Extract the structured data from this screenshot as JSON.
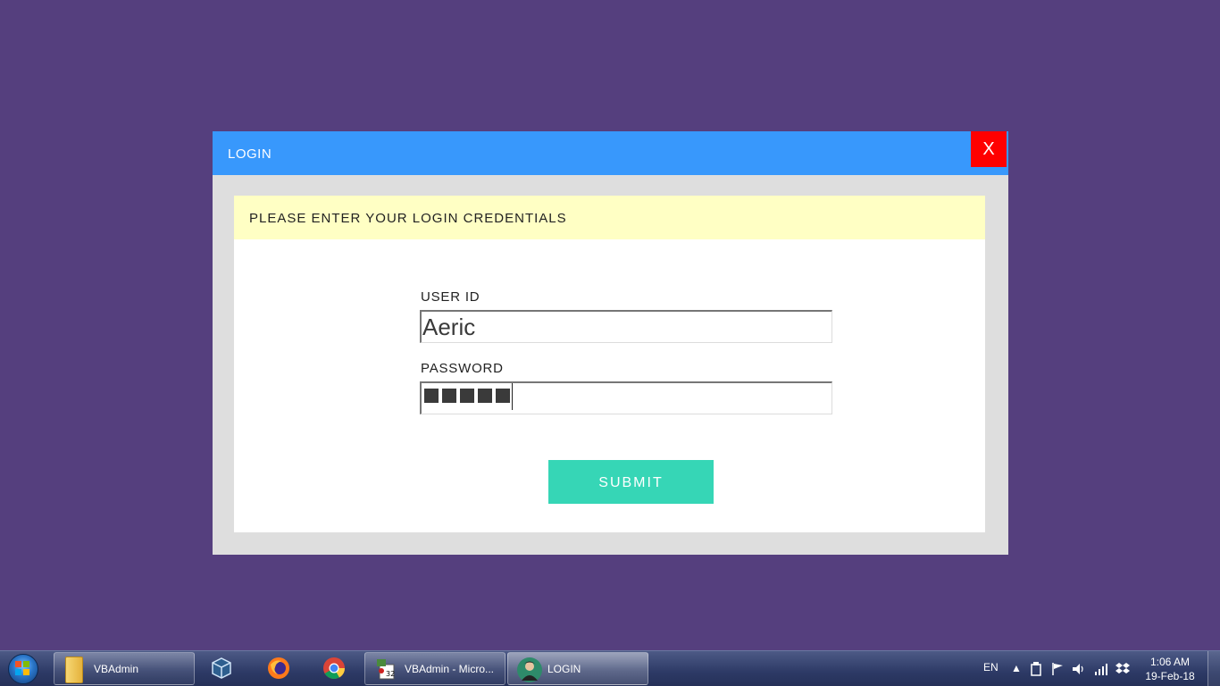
{
  "dialog": {
    "title": "LOGIN",
    "close_label": "X",
    "banner": "PLEASE ENTER YOUR LOGIN CREDENTIALS",
    "user_id_label": "USER ID",
    "user_id_value": "Aeric",
    "password_label": "PASSWORD",
    "password_length": 5,
    "submit_label": "SUBMIT"
  },
  "taskbar": {
    "items": [
      {
        "label": "VBAdmin",
        "icon": "folder-icon"
      },
      {
        "label": "",
        "icon": "virtualbox-icon"
      },
      {
        "label": "",
        "icon": "firefox-icon"
      },
      {
        "label": "",
        "icon": "chrome-icon"
      },
      {
        "label": "VBAdmin - Micro...",
        "icon": "vba-icon"
      },
      {
        "label": "LOGIN",
        "icon": "user-avatar-icon"
      }
    ],
    "tray": {
      "language": "EN",
      "time": "1:06 AM",
      "date": "19-Feb-18"
    }
  },
  "colors": {
    "desktop": "#553f7e",
    "titlebar": "#3898fc",
    "close": "#ff0000",
    "banner": "#ffffc4",
    "submit": "#36d6b6"
  }
}
